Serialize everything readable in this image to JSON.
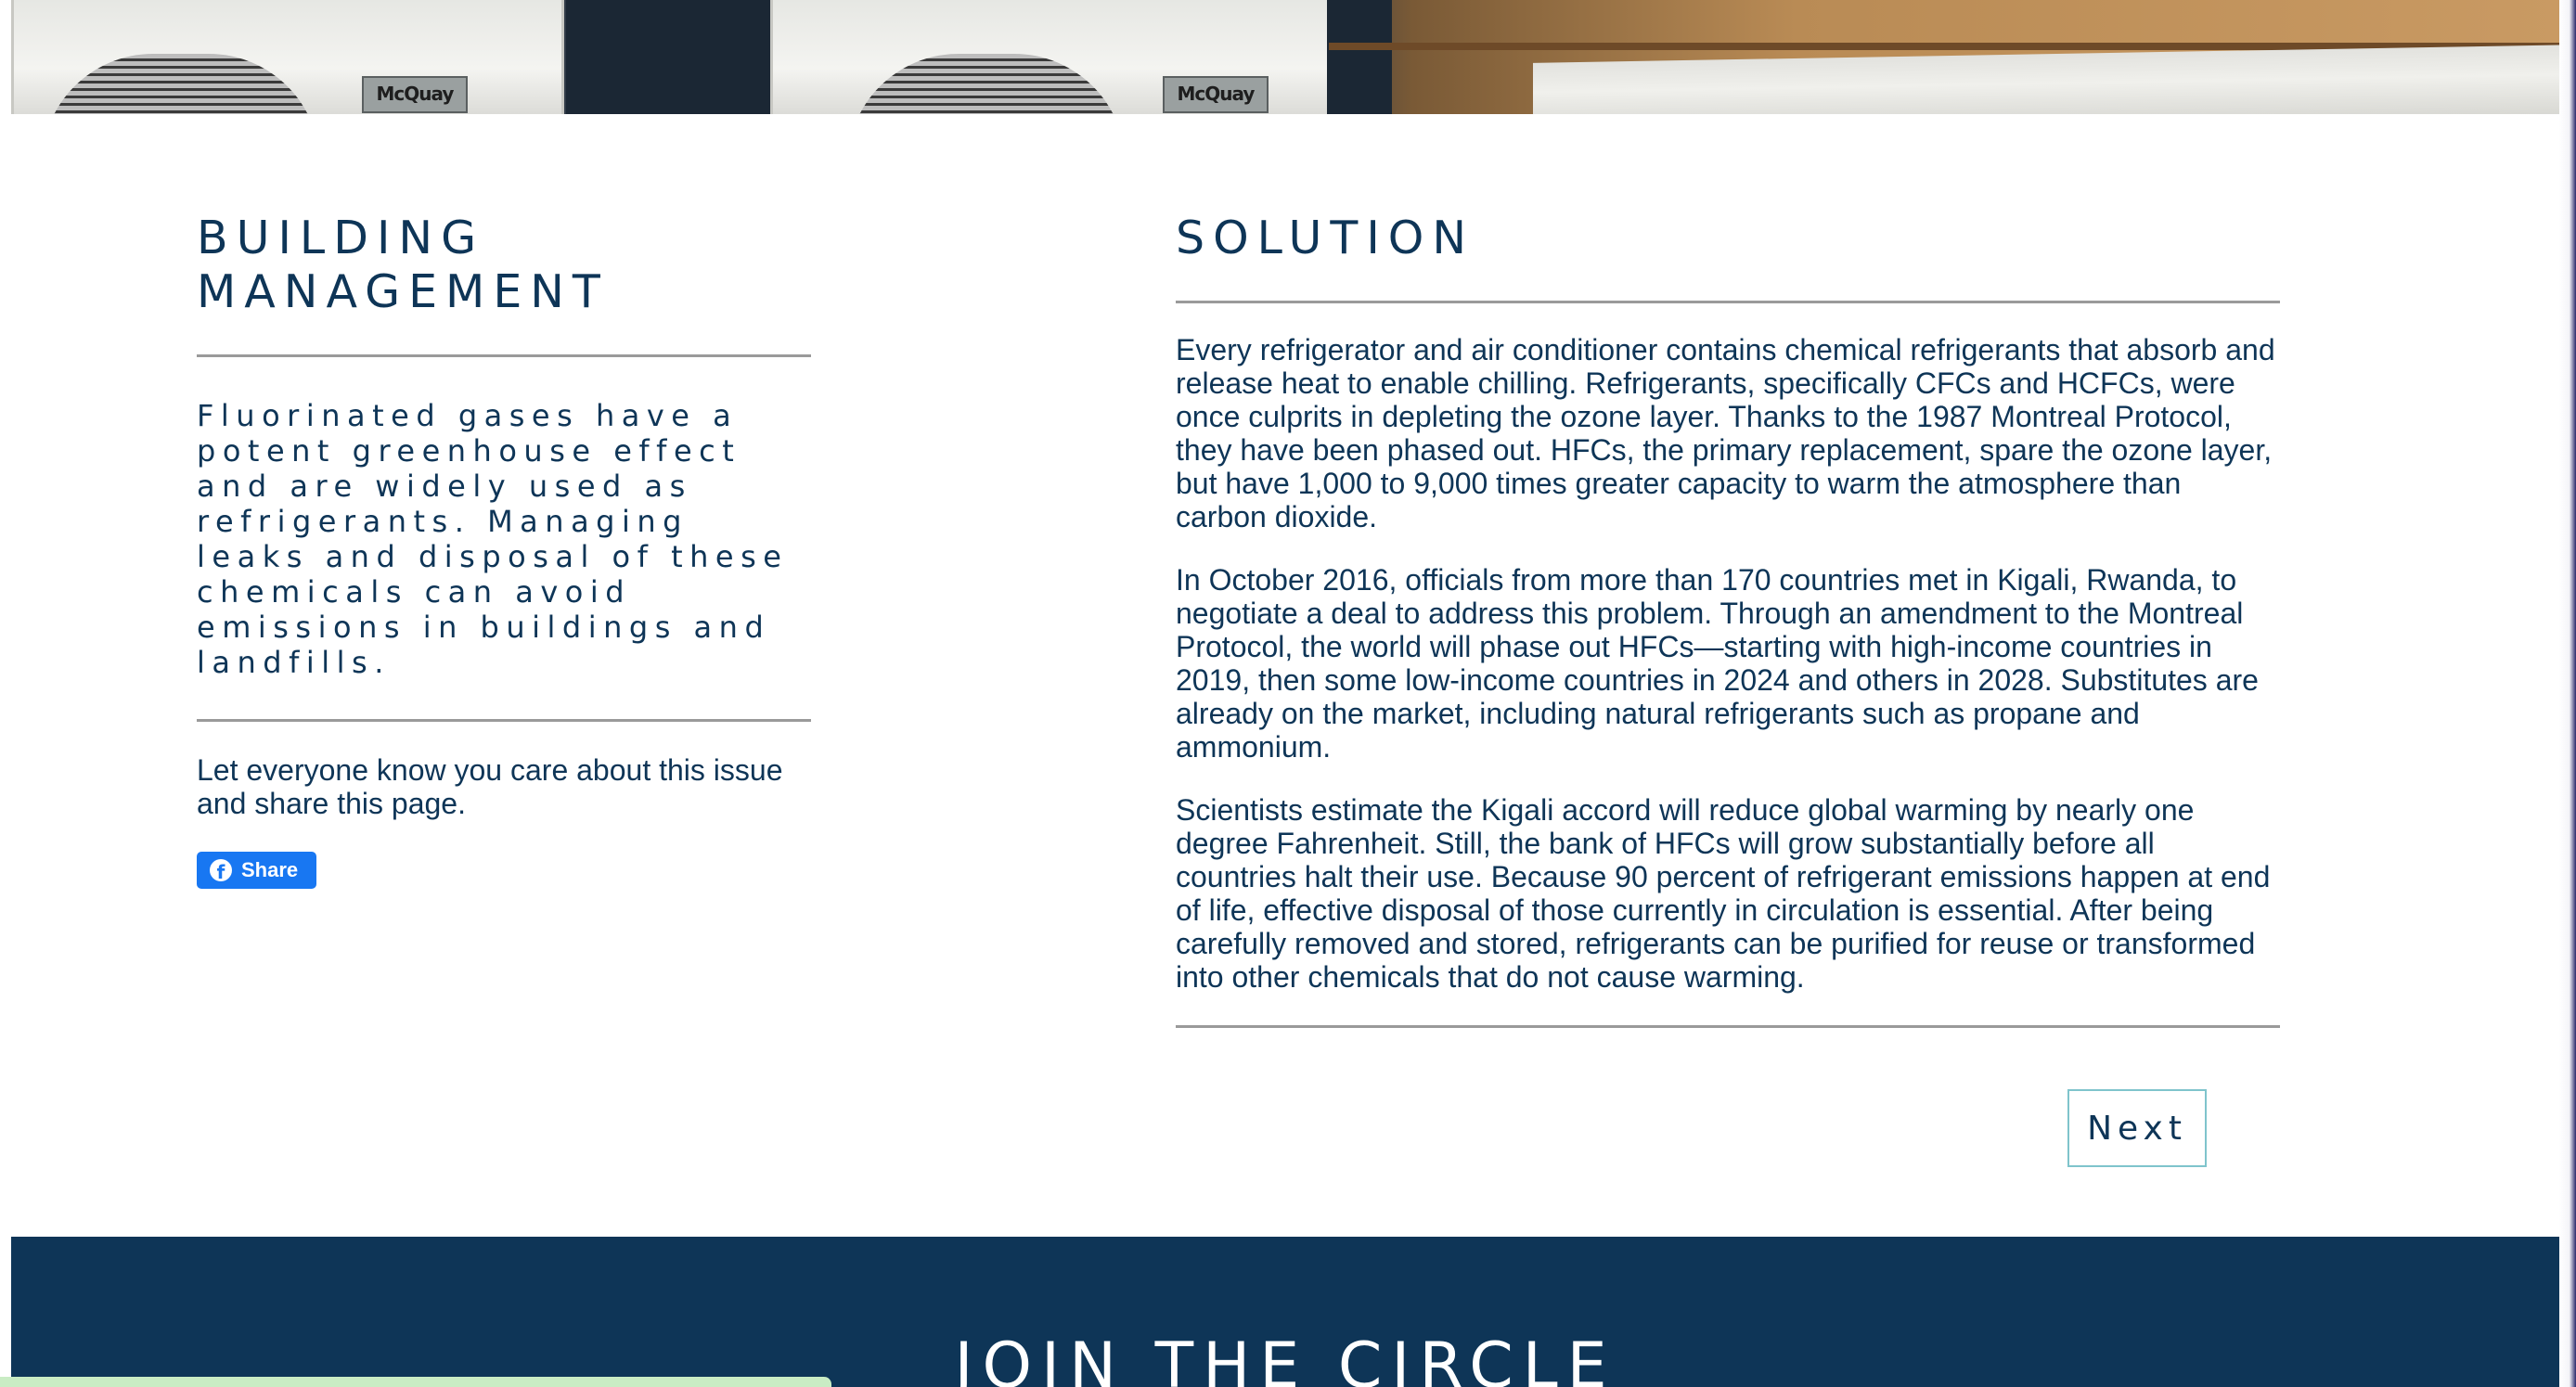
{
  "hero": {
    "brand_labels": [
      "McQuay",
      "McQuay"
    ]
  },
  "left": {
    "title_lines": [
      "BUILDING",
      "MANAGEMENT"
    ],
    "lede": "Fluorinated gases have a potent greenhouse effect and are widely used as refrigerants. Managing leaks and disposal of these chemicals can avoid emissions in buildings and landfills.",
    "share_text": "Let everyone know you care about this issue and share this page.",
    "share_button_label": "Share",
    "share_icon": "facebook-icon"
  },
  "right": {
    "title": "SOLUTION",
    "paragraphs": [
      "Every refrigerator and air conditioner contains chemical refrigerants that absorb and release heat to enable chilling. Refrigerants, specifically CFCs and HCFCs, were once culprits in depleting the ozone layer. Thanks to the 1987 Montreal Protocol, they have been phased out. HFCs, the primary replacement, spare the ozone layer, but have 1,000 to 9,000 times greater capacity to warm the atmosphere than carbon dioxide.",
      "In October 2016, officials from more than 170 countries met in Kigali, Rwanda, to negotiate a deal to address this problem. Through an amendment to the Montreal Protocol, the world will phase out HFCs—starting with high-income countries in 2019, then some low-income countries in 2024 and others in 2028. Substitutes are already on the market, including natural refrigerants such as propane and ammonium.",
      "Scientists estimate the Kigali accord will reduce global warming by nearly one degree Fahrenheit. Still, the bank of HFCs will grow substantially before all countries halt their use. Because 90 percent of refrigerant emissions happen at end of life, effective disposal of those currently in circulation is essential. After being carefully removed and stored, refrigerants can be purified for reuse or transformed into other chemicals that do not cause warming."
    ],
    "next_label": "Next"
  },
  "footer": {
    "title": "JOIN THE CIRCLE"
  },
  "colors": {
    "navy": "#0e3557",
    "rule": "#9a9a9a",
    "facebook": "#1877f2",
    "next_border": "#7fc4cc",
    "bottom_bar": "#c9ecc4"
  }
}
